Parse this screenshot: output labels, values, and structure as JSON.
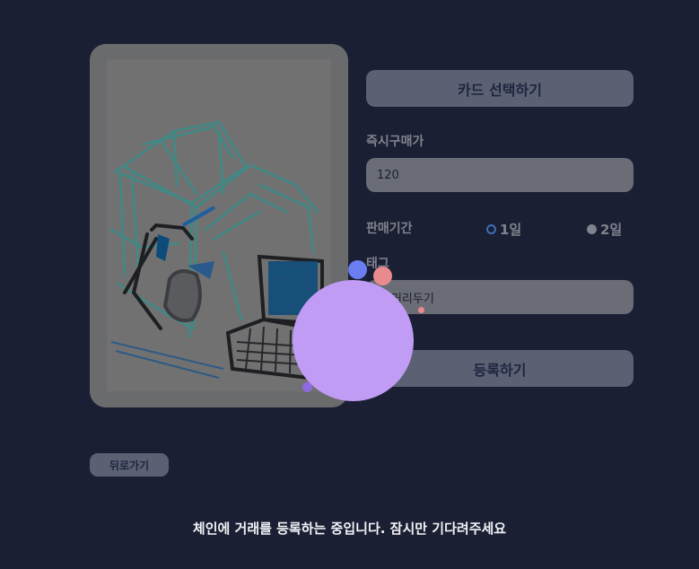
{
  "card_form": {
    "select_card_label": "카드 선택하기",
    "price_label": "즉시구매가",
    "price_value": "120",
    "period_label": "판매기간",
    "period_options": [
      "1일",
      "2일"
    ],
    "period_selected": "1일",
    "tag_label": "태그",
    "tag_value": "적거리두기",
    "submit_label": "등록하기"
  },
  "nav": {
    "back_label": "뒤로가기"
  },
  "status": {
    "message": "체인에 거래를 등록하는 중입니다. 잠시만 기다려주세요"
  },
  "colors": {
    "background": "#1b1f33",
    "button": "#5b6172",
    "loader_main": "#c09cf5",
    "loader_blue": "#6a7ef2",
    "loader_pink": "#e98a8f"
  }
}
